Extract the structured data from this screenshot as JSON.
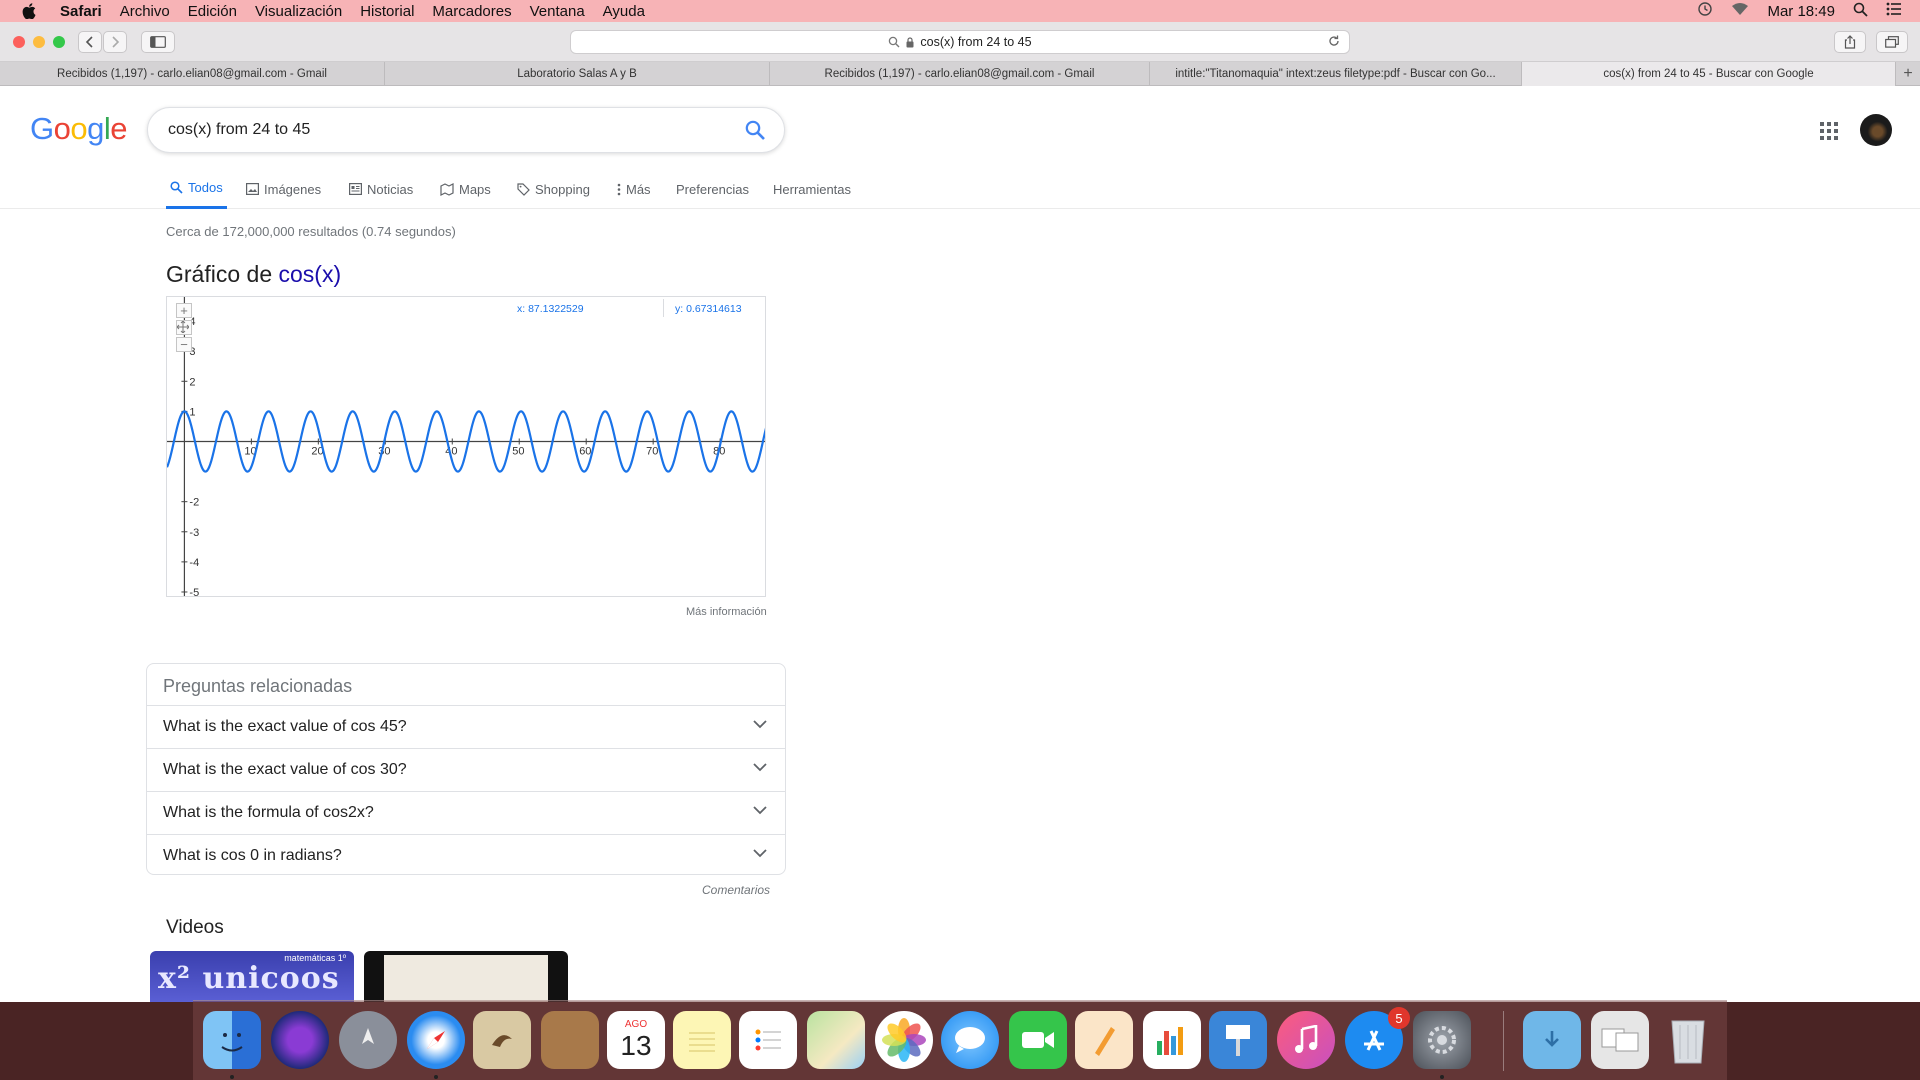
{
  "menubar": {
    "app": "Safari",
    "items": [
      "Archivo",
      "Edición",
      "Visualización",
      "Historial",
      "Marcadores",
      "Ventana",
      "Ayuda"
    ],
    "clock": "Mar 18:49"
  },
  "toolbar": {
    "address": "cos(x) from 24 to 45"
  },
  "tabs": [
    {
      "label": "Recibidos (1,197) - carlo.elian08@gmail.com - Gmail",
      "active": false
    },
    {
      "label": "Laboratorio Salas A y B",
      "active": false
    },
    {
      "label": "Recibidos (1,197) - carlo.elian08@gmail.com - Gmail",
      "active": false
    },
    {
      "label": "intitle:\"Titanomaquia\" intext:zeus filetype:pdf - Buscar con Go...",
      "active": false
    },
    {
      "label": "cos(x) from 24 to 45 - Buscar con Google",
      "active": true
    }
  ],
  "search": {
    "logo": "Google",
    "query": "cos(x) from 24 to 45"
  },
  "nav": {
    "todos": "Todos",
    "imagenes": "Imágenes",
    "noticias": "Noticias",
    "maps": "Maps",
    "shopping": "Shopping",
    "mas": "Más",
    "preferencias": "Preferencias",
    "herramientas": "Herramientas"
  },
  "results": {
    "stats": "Cerca de 172,000,000 resultados (0.74 segundos)",
    "graph_title_prefix": "Gráfico de ",
    "graph_title_fn": "cos(x)",
    "more_info": "Más información"
  },
  "graph": {
    "coord_x": "x: 87.1322529",
    "coord_y": "y: 0.67314613",
    "zoom_in": "+",
    "zoom_out": "−"
  },
  "chart_data": {
    "type": "line",
    "function": "cos(x)",
    "xlim": [
      -2.6,
      87.0
    ],
    "ylim": [
      -5.2,
      4.8
    ],
    "x_ticks": [
      10,
      20,
      30,
      40,
      50,
      60,
      70,
      80
    ],
    "y_ticks": [
      -5,
      -4,
      -3,
      -2,
      1,
      2,
      3,
      4
    ],
    "grid": false,
    "line_color": "#1a73e8",
    "series": [
      {
        "expression": "cos(x)",
        "sample_step": 0.1
      }
    ]
  },
  "paa": {
    "heading": "Preguntas relacionadas",
    "questions": [
      "What is the exact value of cos 45?",
      "What is the exact value of cos 30?",
      "What is the formula of cos2x?",
      "What is cos 0 in radians?"
    ],
    "feedback": "Comentarios"
  },
  "videos": {
    "heading": "Videos",
    "thumb1_text": "x² unicoos",
    "thumb1_small": "matemáticas 1º"
  },
  "dock": {
    "calendar_month": "AGO",
    "calendar_day": "13",
    "appstore_badge": "5"
  }
}
